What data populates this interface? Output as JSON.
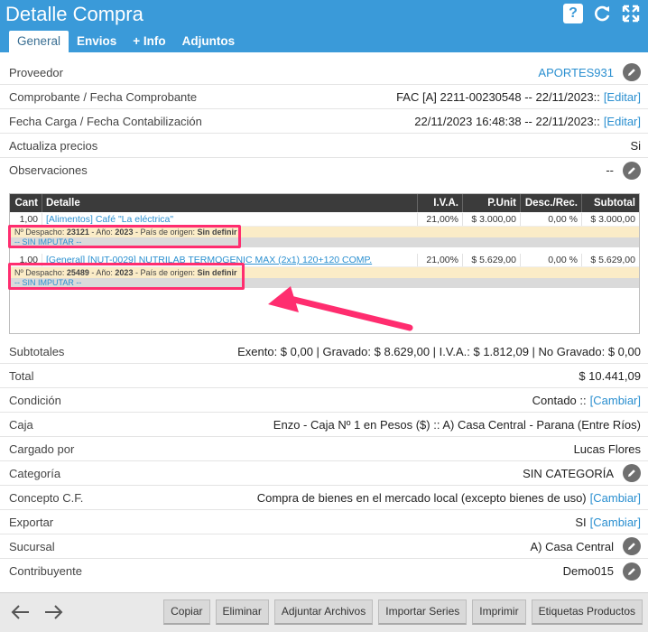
{
  "header": {
    "title": "Detalle Compra",
    "help_symbol": "?",
    "tabs": [
      {
        "label": "General"
      },
      {
        "label": "Envios"
      },
      {
        "label": "+ Info"
      },
      {
        "label": "Adjuntos"
      }
    ]
  },
  "fields": {
    "proveedor": {
      "label": "Proveedor",
      "value": "APORTES931"
    },
    "comprobante": {
      "label": "Comprobante / Fecha Comprobante",
      "value": "FAC [A] 2211-00230548 -- 22/11/2023::",
      "link": "[Editar]"
    },
    "fecha_carga": {
      "label": "Fecha Carga / Fecha Contabilización",
      "value": "22/11/2023 16:48:38 -- 22/11/2023::",
      "link": "[Editar]"
    },
    "actualiza": {
      "label": "Actualiza precios",
      "value": "Si"
    },
    "observaciones": {
      "label": "Observaciones",
      "value": "--"
    }
  },
  "table": {
    "headers": {
      "cant": "Cant",
      "detalle": "Detalle",
      "iva": "I.V.A.",
      "punit": "P.Unit",
      "desc": "Desc./Rec.",
      "subtotal": "Subtotal"
    },
    "items": [
      {
        "cant": "1,00",
        "detalle": "[Alimentos] Café \"La eléctrica\"",
        "iva": "21,00%",
        "punit": "$ 3.000,00",
        "desc": "0,00 %",
        "subtotal": "$ 3.000,00",
        "despacho_prefix": "Nº Despacho:",
        "despacho": "23121",
        "anio_prefix": "- Año:",
        "anio": "2023",
        "pais_prefix": "- País de origen:",
        "pais": "Sin definir",
        "imputar": "-- SIN IMPUTAR --"
      },
      {
        "cant": "1,00",
        "detalle": "[General] [NUT-0029] NUTRILAB TERMOGENIC MAX (2x1) 120+120 COMP.",
        "iva": "21,00%",
        "punit": "$ 5.629,00",
        "desc": "0,00 %",
        "subtotal": "$ 5.629,00",
        "despacho_prefix": "Nº Despacho:",
        "despacho": "25489",
        "anio_prefix": "- Año:",
        "anio": "2023",
        "pais_prefix": "- País de origen:",
        "pais": "Sin definir",
        "imputar": "-- SIN IMPUTAR --"
      }
    ]
  },
  "summary": {
    "subtotales": {
      "label": "Subtotales",
      "value": "Exento: $ 0,00 | Gravado: $ 8.629,00 | I.V.A.: $ 1.812,09 | No Gravado: $ 0,00"
    },
    "total": {
      "label": "Total",
      "value": "$ 10.441,09"
    },
    "condicion": {
      "label": "Condición",
      "value": "Contado ::",
      "link": "[Cambiar]"
    },
    "caja": {
      "label": "Caja",
      "value": "Enzo - Caja Nº 1 en Pesos ($) :: A) Casa Central - Parana (Entre Ríos)"
    },
    "cargado_por": {
      "label": "Cargado por",
      "value": "Lucas Flores"
    },
    "categoria": {
      "label": "Categoría",
      "value": "SIN CATEGORÍA"
    },
    "concepto": {
      "label": "Concepto C.F.",
      "value": "Compra de bienes en el mercado local (excepto bienes de uso)",
      "link": "[Cambiar]"
    },
    "exportar": {
      "label": "Exportar",
      "value": "SI",
      "link": "[Cambiar]"
    },
    "sucursal": {
      "label": "Sucursal",
      "value": "A) Casa Central"
    },
    "contribuyente": {
      "label": "Contribuyente",
      "value": "Demo015"
    }
  },
  "footer": {
    "buttons": [
      "Copiar",
      "Eliminar",
      "Adjuntar Archivos",
      "Importar Series",
      "Imprimir",
      "Etiquetas Productos"
    ]
  },
  "colors": {
    "header": "#3a9ad9",
    "link": "#2a8fd0",
    "highlight": "#ff2d6f"
  }
}
